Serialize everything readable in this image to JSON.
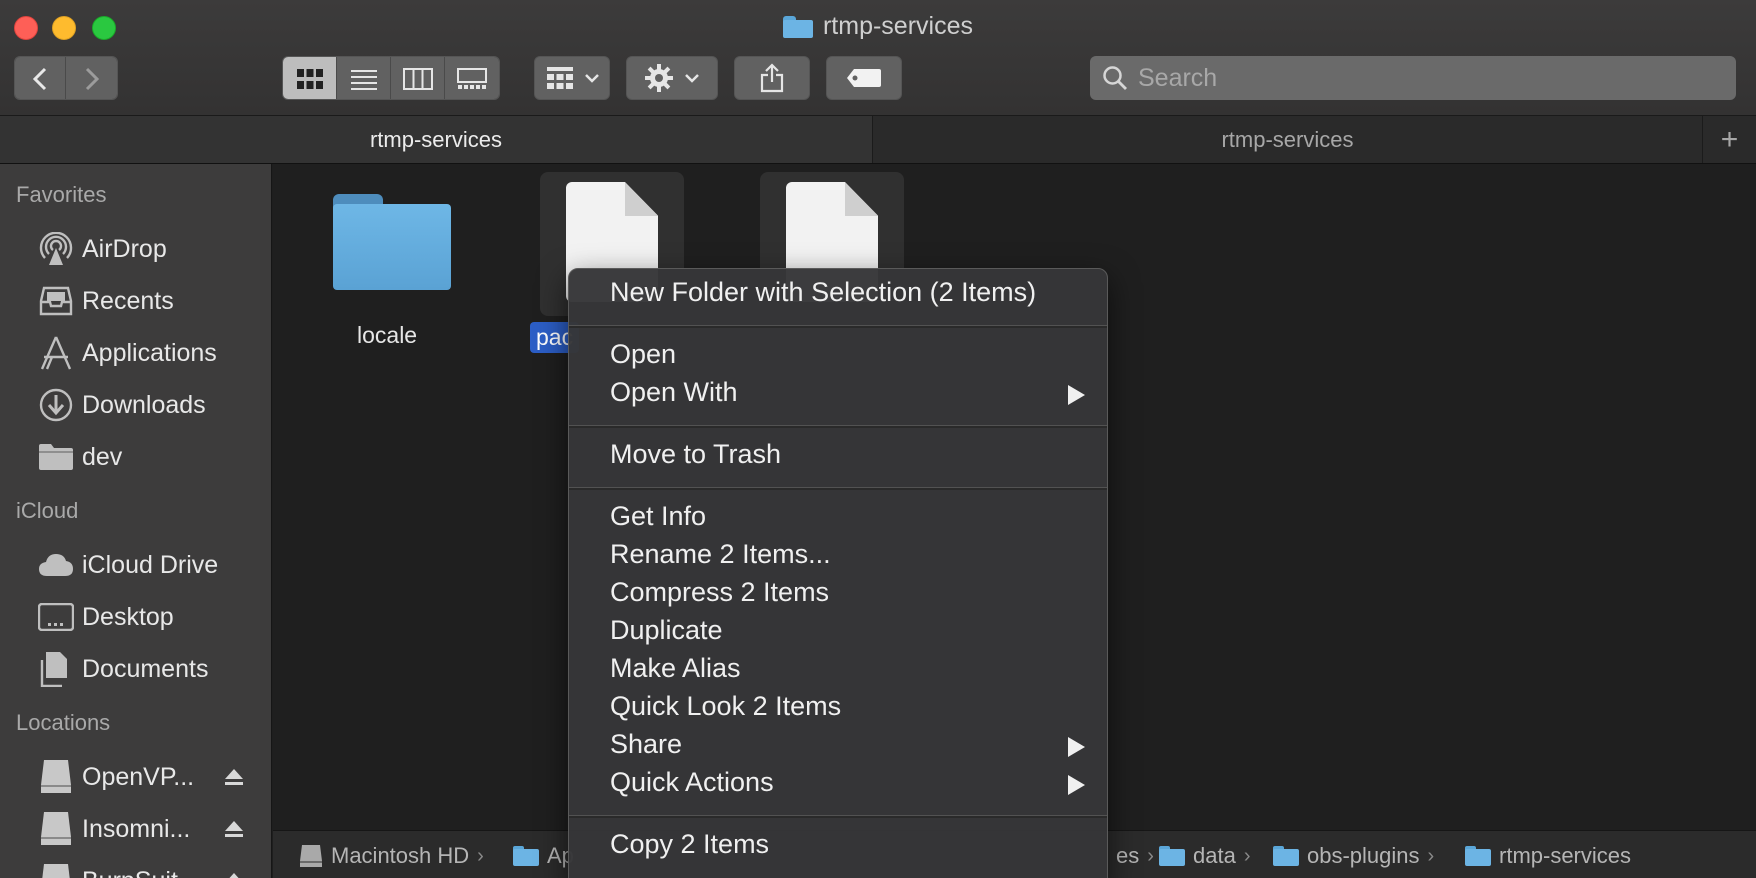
{
  "window": {
    "title": "rtmp-services"
  },
  "search": {
    "placeholder": "Search"
  },
  "tabs": [
    {
      "label": "rtmp-services"
    },
    {
      "label": "rtmp-services"
    },
    {
      "label": "+"
    }
  ],
  "sidebar": {
    "favorites_header": "Favorites",
    "favorites": [
      {
        "label": "AirDrop",
        "icon": "airdrop-icon"
      },
      {
        "label": "Recents",
        "icon": "recents-icon"
      },
      {
        "label": "Applications",
        "icon": "applications-icon"
      },
      {
        "label": "Downloads",
        "icon": "downloads-icon"
      },
      {
        "label": "dev",
        "icon": "folder-icon"
      }
    ],
    "icloud_header": "iCloud",
    "icloud": [
      {
        "label": "iCloud Drive",
        "icon": "cloud-icon"
      },
      {
        "label": "Desktop",
        "icon": "desktop-icon"
      },
      {
        "label": "Documents",
        "icon": "documents-icon"
      }
    ],
    "locations_header": "Locations",
    "locations": [
      {
        "label": "OpenVP...",
        "icon": "drive-icon"
      },
      {
        "label": "Insomni...",
        "icon": "drive-icon"
      },
      {
        "label": "BurpSuit...",
        "icon": "drive-icon"
      }
    ]
  },
  "files": {
    "folder_label": "locale",
    "selected_label_partial": "pac"
  },
  "context_menu": {
    "new_folder": "New Folder with Selection (2 Items)",
    "open": "Open",
    "open_with": "Open With",
    "move_to_trash": "Move to Trash",
    "get_info": "Get Info",
    "rename": "Rename 2 Items...",
    "compress": "Compress 2 Items",
    "duplicate": "Duplicate",
    "make_alias": "Make Alias",
    "quick_look": "Quick Look 2 Items",
    "share": "Share",
    "quick_actions": "Quick Actions",
    "copy": "Copy 2 Items"
  },
  "pathbar": {
    "root": "Macintosh HD",
    "second_partial": "Ap",
    "third_partial": "es",
    "data": "data",
    "obs_plugins": "obs-plugins",
    "rtmp_services": "rtmp-services"
  },
  "colors": {
    "selection": "#2c5ec6",
    "folder": "#6cb4e4",
    "close": "#fe5f57",
    "minimize": "#febb2e",
    "zoom": "#2ac840"
  }
}
